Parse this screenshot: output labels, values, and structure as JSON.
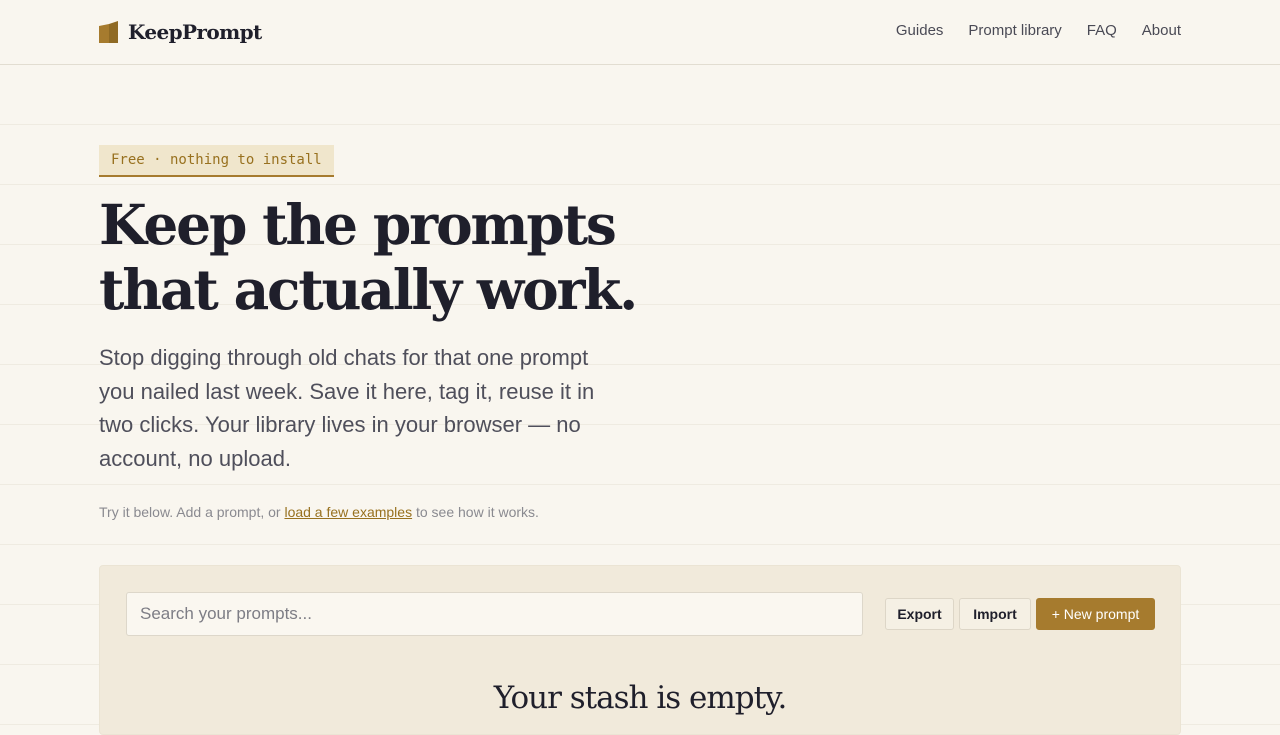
{
  "brand": {
    "name": "KeepPrompt",
    "icon": "book-icon",
    "accent": "#a67b2e"
  },
  "nav": {
    "items": [
      "Guides",
      "Prompt library",
      "FAQ",
      "About"
    ]
  },
  "hero": {
    "badge": "Free · nothing to install",
    "headline_line1": "Keep the prompts",
    "headline_line2": "that actually work.",
    "lede": "Stop digging through old chats for that one prompt you nailed last week. Save it here, tag it, reuse it in two clicks. Your library lives in your browser — no account, no upload.",
    "hint_before": "Try it below. Add a prompt, or ",
    "hint_link": "load a few examples",
    "hint_after": " to see how it works."
  },
  "library": {
    "search_placeholder": "Search your prompts...",
    "search_value": "",
    "export_label": "Export",
    "import_label": "Import",
    "new_label": "+ New prompt",
    "empty_title": "Your stash is empty."
  }
}
